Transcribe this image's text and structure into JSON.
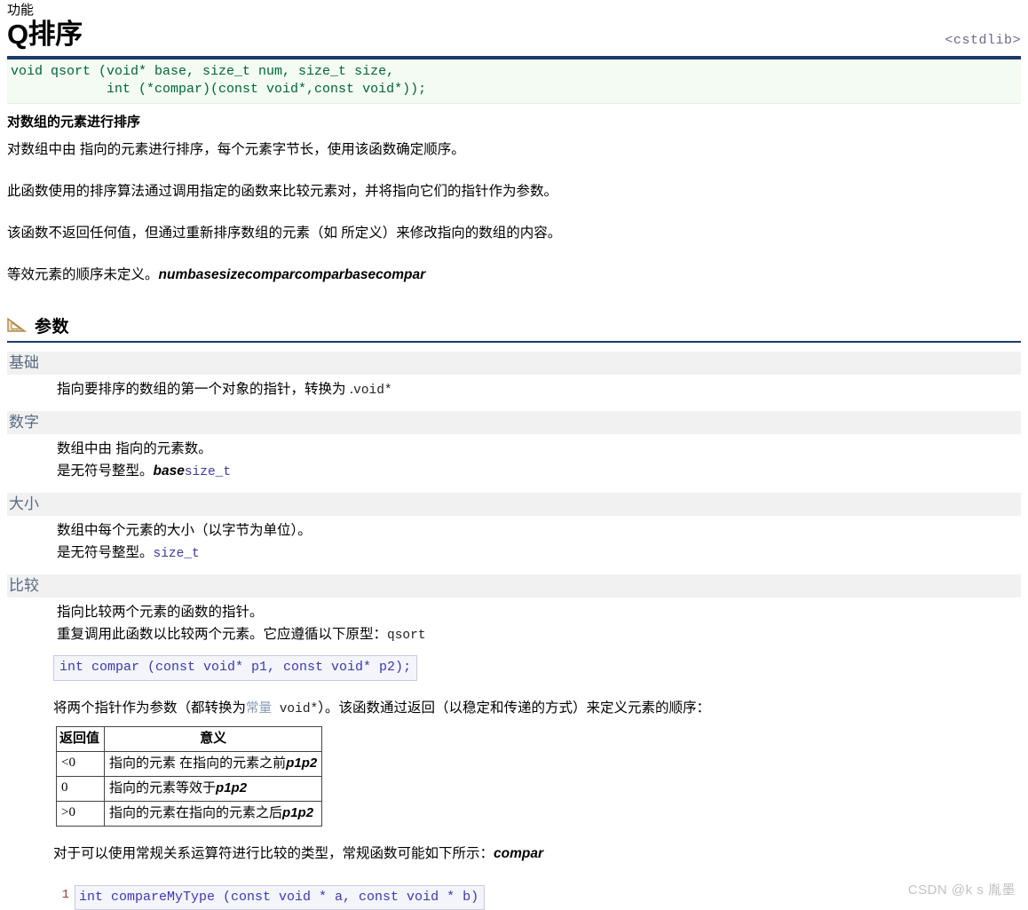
{
  "header": {
    "kicker": "功能",
    "title": "Q排序",
    "include": "<cstdlib>"
  },
  "signature": {
    "line1": "void qsort (void* base, size_t num, size_t size,",
    "line2": "            int (*compar)(const void*,const void*));"
  },
  "overview": {
    "lead": "对数组的元素进行排序",
    "paragraphs": [
      "对数组中由 指向的元素进行排序，每个元素字节长，使用该函数确定顺序。",
      "此函数使用的排序算法通过调用指定的函数来比较元素对，并将指向它们的指针作为参数。",
      "该函数不返回任何值，但通过重新排序数组的元素（如 所定义）来修改指向的数组的内容。"
    ],
    "last_paragraph_prefix": "等效元素的顺序未定义。",
    "last_paragraph_italic": "numbasesizecomparcomparbasecompar"
  },
  "parameters_section": {
    "icon": "ruler-triangle-icon",
    "title": "参数",
    "items": [
      {
        "name": "基础",
        "lines": [
          {
            "text": "指向要排序的数组的第一个对象的指针，转换为 .",
            "code": "void*",
            "code_style": "dark"
          }
        ]
      },
      {
        "name": "数字",
        "lines": [
          {
            "text": "数组中由 指向的元素数。",
            "code": "",
            "code_style": "dark"
          },
          {
            "text": "是无符号整型。",
            "italic": "base",
            "code": "size_t",
            "code_style": "blue"
          }
        ]
      },
      {
        "name": "大小",
        "lines": [
          {
            "text": "数组中每个元素的大小（以字节为单位）。",
            "code": "",
            "code_style": "dark"
          },
          {
            "text": "是无符号整型。",
            "code": "size_t",
            "code_style": "blue"
          }
        ]
      },
      {
        "name": "比较",
        "lines": [
          {
            "text": "指向比较两个元素的函数的指针。",
            "code": "",
            "code_style": "dark"
          },
          {
            "text": "重复调用此函数以比较两个元素。它应遵循以下原型：",
            "code": "qsort",
            "code_style": "dark"
          }
        ]
      }
    ]
  },
  "compar_prototype": "int compar (const void* p1, const void* p2);",
  "compar_paragraph": {
    "part1": "将两个指针作为参数（都转换为",
    "kw": "常量",
    "code": " void*",
    "part2": "）。该函数通过返回（以稳定和传递的方式）来定义元素的顺序："
  },
  "return_table": {
    "headers": [
      "返回值",
      "意义"
    ],
    "rows": [
      {
        "value": "<0",
        "meaning": "指向的元素 在指向的元素之前",
        "italic": "p1p2"
      },
      {
        "value": "0",
        "meaning": "指向的元素等效于",
        "italic": "p1p2"
      },
      {
        "value": ">0",
        "meaning": "指向的元素在指向的元素之后",
        "italic": "p1p2"
      }
    ]
  },
  "closing_paragraph": {
    "text": "对于可以使用常规关系运算符进行比较的类型，常规函数可能如下所示：",
    "italic": "compar"
  },
  "code_listing": {
    "line_number": "1",
    "code": "int compareMyType (const void * a, const void * b)"
  },
  "watermark": "CSDN @k s 胤墨",
  "colors": {
    "rule": "#1b3a6b",
    "signature_text": "#006633",
    "signature_bg": "#f3fbf3",
    "param_band": "#f1f1f1",
    "param_name": "#5a6a84",
    "code_blue": "#3a3ab0",
    "watermark": "#c2c2c2"
  }
}
